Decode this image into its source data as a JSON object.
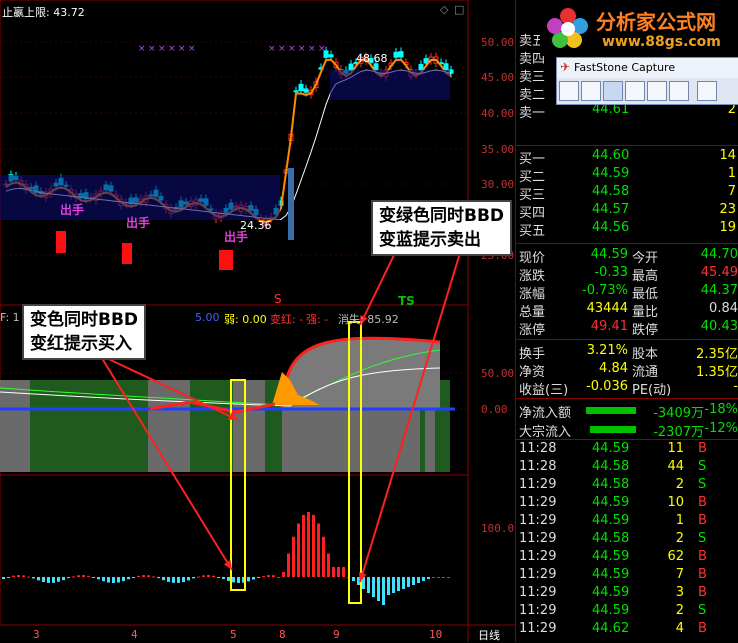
{
  "chart": {
    "top_label": "止嬴上限: 43.72",
    "price_axis": [
      "50.00",
      "45.00",
      "40.00",
      "35.00",
      "30.00",
      "25.00"
    ],
    "high_annotation": "48.68",
    "low_annotation": "24.36",
    "signal_texts": [
      "出手",
      "出手",
      "出手"
    ],
    "indicator_header": {
      "prefix": "F: 1",
      "value1": "5.00",
      "weak": "弱: 0.00",
      "change": "变红: -",
      "strong": "强: -",
      "disappear": "消失: 85.92"
    },
    "indicator_axis": [
      "50.00",
      "0.00"
    ],
    "bottom_axis": [
      "100.0"
    ],
    "x_labels": [
      "3",
      "4",
      "5",
      "8",
      "9",
      "10"
    ],
    "period_label": "日线",
    "s_marker": "S",
    "ts_marker": "TS",
    "callout_sell": [
      "变绿色同时BBD",
      "变蓝提示卖出"
    ],
    "callout_buy": [
      "变色同时BBD",
      "变红提示买入"
    ]
  },
  "logo": {
    "brand": "分析家公式网",
    "url": "www.88gs.com"
  },
  "faststone": {
    "title": "FastStone Capture"
  },
  "quote": {
    "ask_rows": [
      {
        "label": "卖五",
        "price": "",
        "vol": ""
      },
      {
        "label": "卖四",
        "price": "",
        "vol": ""
      },
      {
        "label": "卖三",
        "price": "",
        "vol": ""
      },
      {
        "label": "卖二",
        "price": "44.62",
        "vol": "1"
      },
      {
        "label": "卖一",
        "price": "44.61",
        "vol": "2"
      }
    ],
    "bid_rows": [
      {
        "label": "买一",
        "price": "44.60",
        "vol": "14"
      },
      {
        "label": "买二",
        "price": "44.59",
        "vol": "1"
      },
      {
        "label": "买三",
        "price": "44.58",
        "vol": "7"
      },
      {
        "label": "买四",
        "price": "44.57",
        "vol": "23"
      },
      {
        "label": "买五",
        "price": "44.56",
        "vol": "19"
      }
    ],
    "stats": [
      {
        "l1": "现价",
        "v1": "44.59",
        "l2": "今开",
        "v2": "44.70"
      },
      {
        "l1": "涨跌",
        "v1": "-0.33",
        "l2": "最高",
        "v2": "45.49"
      },
      {
        "l1": "涨幅",
        "v1": "-0.73%",
        "l2": "最低",
        "v2": "44.37"
      },
      {
        "l1": "总量",
        "v1": "43444",
        "l2": "量比",
        "v2": "0.84"
      },
      {
        "l1": "涨停",
        "v1": "49.41",
        "l2": "跌停",
        "v2": "40.43"
      }
    ],
    "stats2": [
      {
        "l1": "换手",
        "v1": "3.21%",
        "l2": "股本",
        "v2": "2.35亿"
      },
      {
        "l1": "净资",
        "v1": "4.84",
        "l2": "流通",
        "v2": "1.35亿"
      },
      {
        "l1": "收益(三)",
        "v1": "-0.036",
        "l2": "PE(动)",
        "v2": "-"
      }
    ],
    "flows": [
      {
        "label": "净流入额",
        "value": "-3409万",
        "pct": "-18%"
      },
      {
        "label": "大宗流入",
        "value": "-2307万",
        "pct": "-12%"
      }
    ],
    "ticks": [
      {
        "t": "11:28",
        "p": "44.59",
        "v": "11",
        "s": "B"
      },
      {
        "t": "11:28",
        "p": "44.58",
        "v": "44",
        "s": "S"
      },
      {
        "t": "11:29",
        "p": "44.58",
        "v": "2",
        "s": "S"
      },
      {
        "t": "11:29",
        "p": "44.59",
        "v": "10",
        "s": "B"
      },
      {
        "t": "11:29",
        "p": "44.59",
        "v": "1",
        "s": "B"
      },
      {
        "t": "11:29",
        "p": "44.58",
        "v": "2",
        "s": "S"
      },
      {
        "t": "11:29",
        "p": "44.59",
        "v": "62",
        "s": "B"
      },
      {
        "t": "11:29",
        "p": "44.59",
        "v": "7",
        "s": "B"
      },
      {
        "t": "11:29",
        "p": "44.59",
        "v": "3",
        "s": "B"
      },
      {
        "t": "11:29",
        "p": "44.59",
        "v": "2",
        "s": "S"
      },
      {
        "t": "11:29",
        "p": "44.62",
        "v": "4",
        "s": "B"
      }
    ]
  },
  "colors": {
    "up": "#ff3030",
    "down": "#00e0e0",
    "accent": "#ffff00"
  }
}
